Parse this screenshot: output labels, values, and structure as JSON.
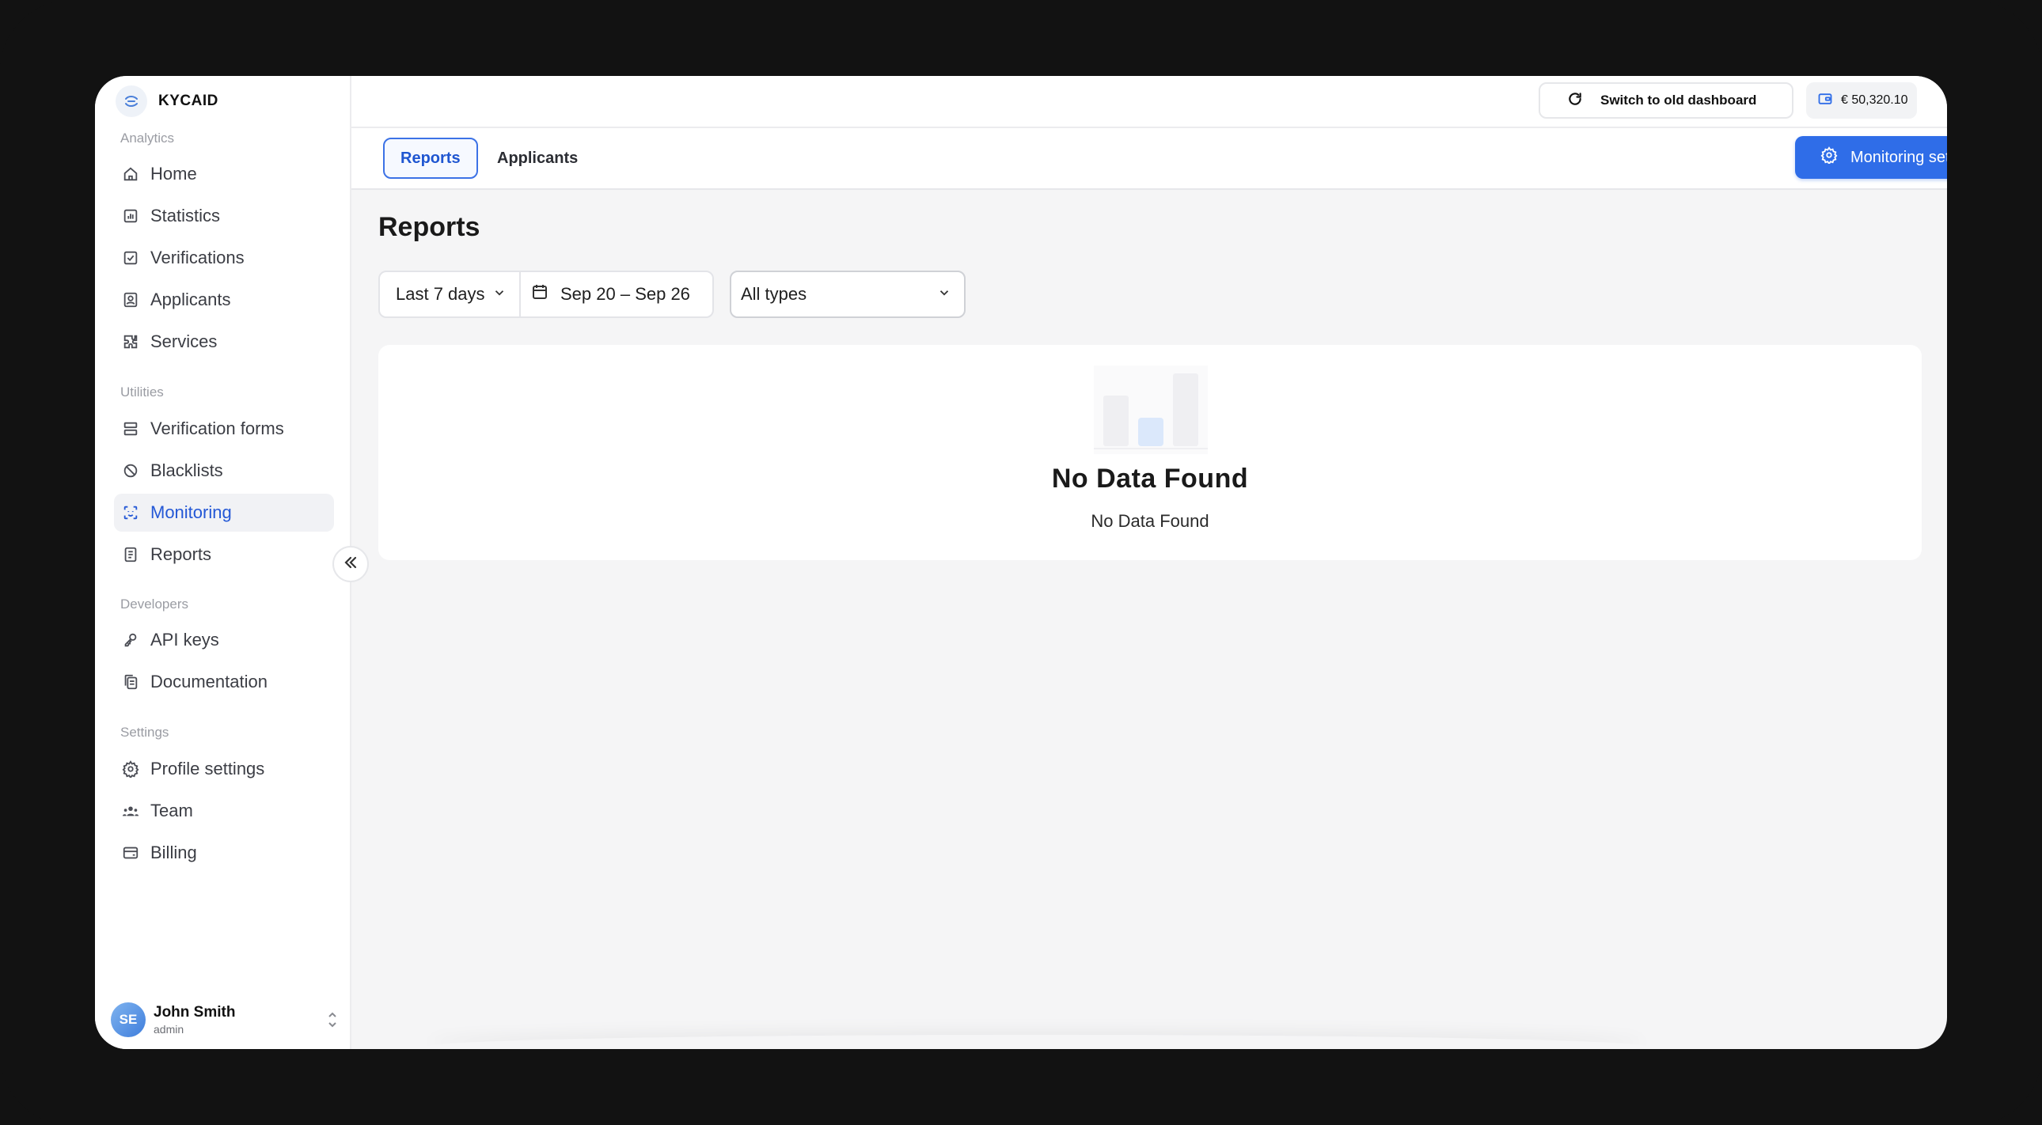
{
  "brand": {
    "name": "KYCAID"
  },
  "sidebar": {
    "sections": [
      {
        "label": "Analytics"
      },
      {
        "label": "Utilities"
      },
      {
        "label": "Developers"
      },
      {
        "label": "Settings"
      }
    ],
    "items": [
      {
        "label": "Home",
        "icon": "home-icon"
      },
      {
        "label": "Statistics",
        "icon": "statistics-icon"
      },
      {
        "label": "Verifications",
        "icon": "verifications-icon"
      },
      {
        "label": "Applicants",
        "icon": "applicants-icon"
      },
      {
        "label": "Services",
        "icon": "services-icon"
      },
      {
        "label": "Verification forms",
        "icon": "forms-icon"
      },
      {
        "label": "Blacklists",
        "icon": "blacklist-icon"
      },
      {
        "label": "Monitoring",
        "icon": "monitoring-icon",
        "active": true
      },
      {
        "label": "Reports",
        "icon": "reports-icon"
      },
      {
        "label": "API keys",
        "icon": "key-icon"
      },
      {
        "label": "Documentation",
        "icon": "documentation-icon"
      },
      {
        "label": "Profile settings",
        "icon": "gear-icon"
      },
      {
        "label": "Team",
        "icon": "team-icon"
      },
      {
        "label": "Billing",
        "icon": "billing-icon"
      }
    ]
  },
  "user": {
    "initials": "SE",
    "name": "John Smith",
    "role": "admin"
  },
  "topbar": {
    "switch_label": "Switch to old dashboard",
    "balance": "€ 50,320.10"
  },
  "tabs": [
    {
      "label": "Reports",
      "active": true
    },
    {
      "label": "Applicants",
      "active": false
    }
  ],
  "monitoring_button": "Monitoring settings",
  "main": {
    "title": "Reports",
    "range": "Last 7 days",
    "dates": "Sep 20 – Sep 26",
    "type_filter": "All types",
    "empty_title": "No Data Found",
    "empty_subtitle": "No Data Found"
  },
  "colors": {
    "accent": "#2f6de8",
    "active_text": "#2458d6"
  }
}
